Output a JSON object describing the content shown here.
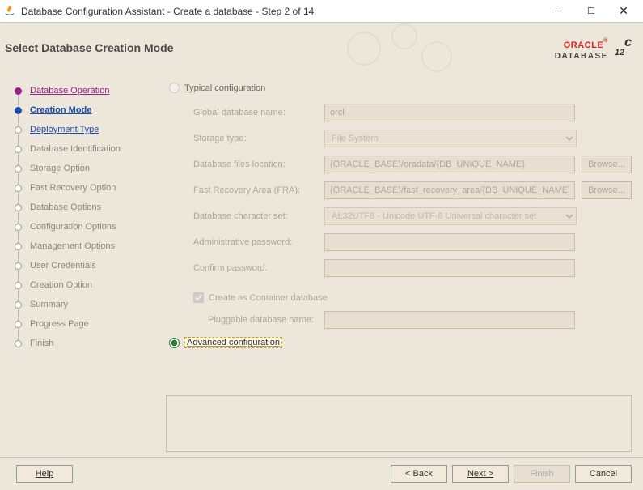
{
  "window": {
    "title": "Database Configuration Assistant - Create a database - Step 2 of 14"
  },
  "header": {
    "page_title": "Select Database Creation Mode",
    "brand": "ORACLE",
    "brand_sub": "DATABASE",
    "version": "12",
    "version_sup": "c"
  },
  "sidebar": {
    "steps": [
      {
        "label": "Database Operation"
      },
      {
        "label": "Creation Mode"
      },
      {
        "label": "Deployment Type"
      },
      {
        "label": "Database Identification"
      },
      {
        "label": "Storage Option"
      },
      {
        "label": "Fast Recovery Option"
      },
      {
        "label": "Database Options"
      },
      {
        "label": "Configuration Options"
      },
      {
        "label": "Management Options"
      },
      {
        "label": "User Credentials"
      },
      {
        "label": "Creation Option"
      },
      {
        "label": "Summary"
      },
      {
        "label": "Progress Page"
      },
      {
        "label": "Finish"
      }
    ]
  },
  "radios": {
    "typical": "Typical configuration",
    "advanced": "Advanced configuration"
  },
  "form": {
    "gdn_label": "Global database name:",
    "gdn_value": "orcl",
    "storage_label": "Storage type:",
    "storage_value": "File System",
    "files_label": "Database files location:",
    "files_value": "{ORACLE_BASE}/oradata/{DB_UNIQUE_NAME}",
    "fra_label": "Fast Recovery Area (FRA):",
    "fra_value": "{ORACLE_BASE}/fast_recovery_area/{DB_UNIQUE_NAME}",
    "charset_label": "Database character set:",
    "charset_value": "AL32UTF8 - Unicode UTF-8 Universal character set",
    "admin_label": "Administrative password:",
    "confirm_label": "Confirm password:",
    "container_chk": "Create as Container database",
    "pdb_label": "Pluggable database name:",
    "browse": "Browse..."
  },
  "footer": {
    "help": "Help",
    "back": "< Back",
    "next": "Next >",
    "finish": "Finish",
    "cancel": "Cancel"
  }
}
